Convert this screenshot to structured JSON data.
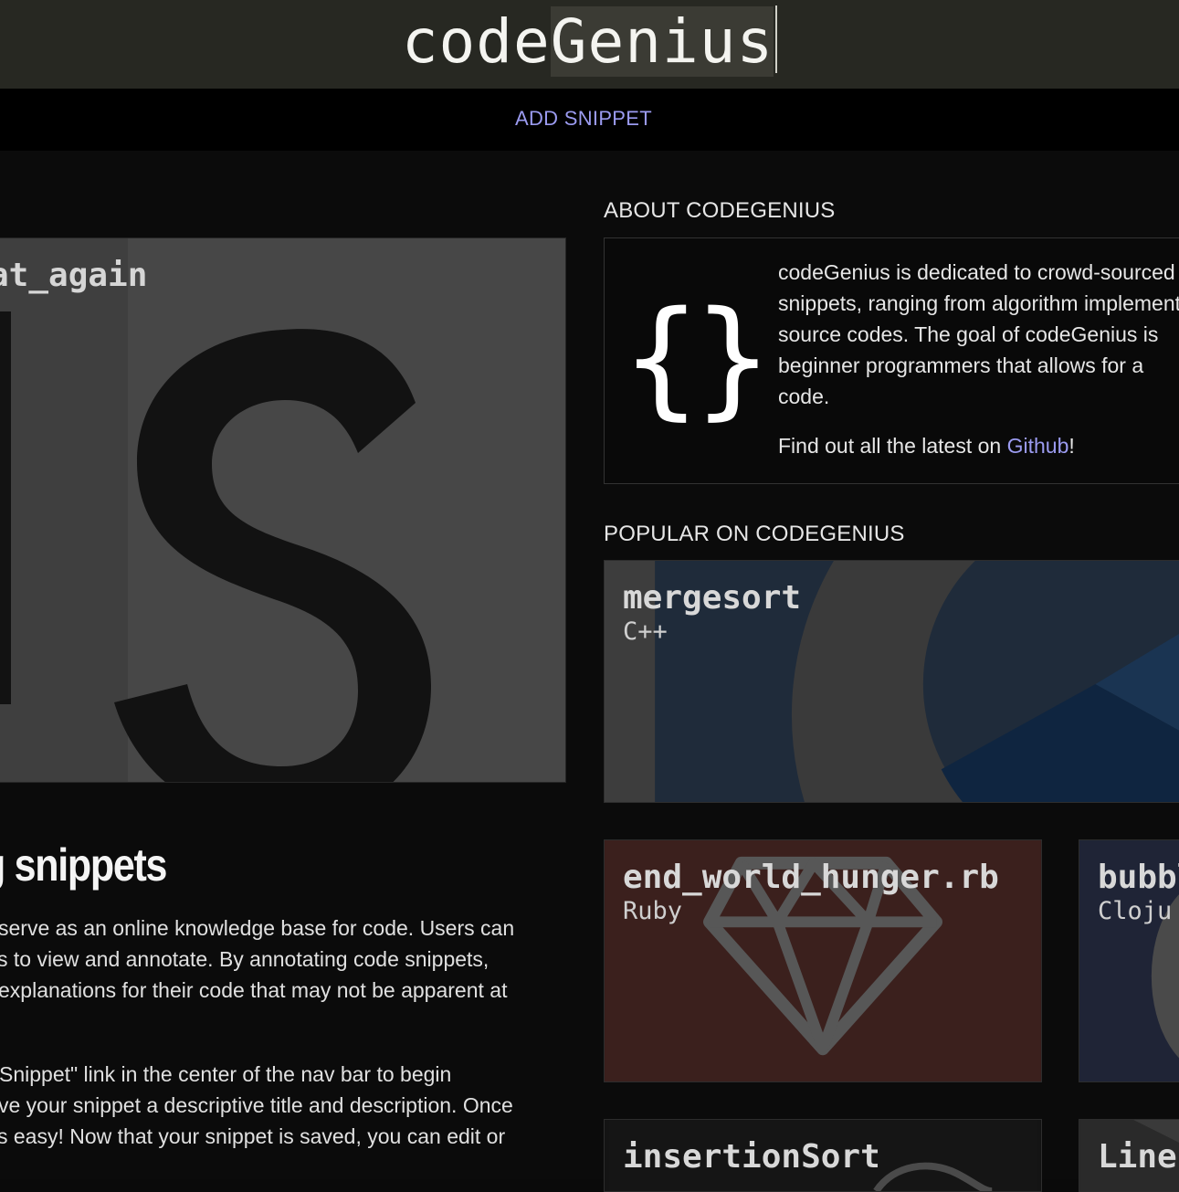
{
  "header": {
    "logo_part1": "code",
    "logo_part2": "Genius"
  },
  "nav": {
    "add_snippet": "ADD SNIPPET"
  },
  "featured": {
    "title": "at_again",
    "image_icon": "js-logo-icon"
  },
  "intro": {
    "title": "g snippets",
    "para1": [
      "serve as an online knowledge base for code. Users can",
      "s to view and annotate. By annotating code snippets,",
      "explanations for their code that may not be apparent at"
    ],
    "para2": [
      "Snippet\" link in the center of the nav bar to begin",
      "ve your snippet a descriptive title and description. Once",
      "s easy! Now that your snippet is saved, you can edit or"
    ]
  },
  "about": {
    "heading": "ABOUT CODEGENIUS",
    "icon": "curly-braces-icon",
    "icon_text": "{}",
    "lines": [
      "codeGenius is dedicated to crowd-sourced",
      "snippets, ranging from algorithm implementations",
      "source codes. The goal of codeGenius is",
      "beginner programmers that allows for a",
      "code."
    ],
    "github_prefix": "Find out all the latest on ",
    "github_link": "Github",
    "github_suffix": "!"
  },
  "popular": {
    "heading": "POPULAR ON CODEGENIUS",
    "cards": [
      {
        "title": "mergesort",
        "lang": "C++",
        "icon": "cpp-logo-icon"
      },
      {
        "title": "end_world_hunger.rb",
        "lang": "Ruby",
        "icon": "ruby-gem-icon"
      },
      {
        "title": "bubbl",
        "lang": "Cloju",
        "icon": "clojure-logo-icon"
      },
      {
        "title": "insertionSort",
        "lang": "",
        "icon": "language-logo-icon"
      },
      {
        "title": "Line",
        "lang": "",
        "icon": "language-logo-icon"
      }
    ]
  },
  "colors": {
    "header_bg": "#272822",
    "link": "#9b9bf0",
    "ruby_card": "#3a1f1c",
    "cpp_card": "#3f3f3f",
    "clojure_card": "#1f2436"
  }
}
